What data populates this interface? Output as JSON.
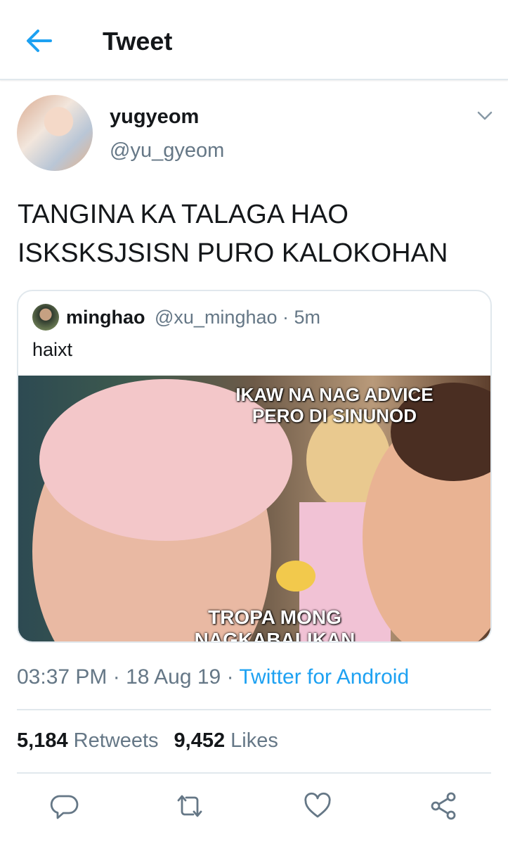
{
  "header": {
    "title": "Tweet"
  },
  "tweet": {
    "display_name": "yugyeom",
    "handle": "@yu_gyeom",
    "text": "TANGINA KA TALAGA HAO\nISKSKSJSISN PURO KALOKOHAN"
  },
  "quote": {
    "display_name": "minghao",
    "meta": "@xu_minghao · 5m",
    "text": "haixt",
    "meme_top": "IKAW NA NAG ADVICE\nPERO DI SINUNOD",
    "meme_bottom": "TROPA MONG\nNAGKABALIKAN"
  },
  "meta": {
    "time": "03:37 PM",
    "sep1": " · ",
    "date": "18 Aug 19",
    "sep2": " · ",
    "source": "Twitter for Android"
  },
  "stats": {
    "retweets_count": "5,184",
    "retweets_label": "Retweets",
    "likes_count": "9,452",
    "likes_label": "Likes"
  },
  "icons": {
    "back": "arrow-left-icon",
    "caret": "chevron-down-icon",
    "reply": "reply-icon",
    "retweet": "retweet-icon",
    "like": "heart-icon",
    "share": "share-icon"
  },
  "colors": {
    "accent": "#1da1f2",
    "secondary_text": "#657786",
    "divider": "#e1e8ed"
  }
}
